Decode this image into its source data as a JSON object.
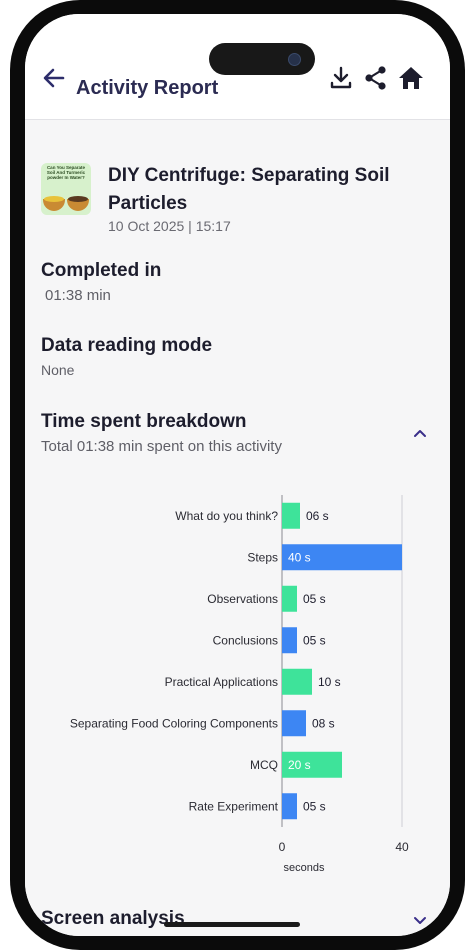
{
  "header": {
    "title": "Activity Report",
    "icons": [
      "back-arrow-icon",
      "download-icon",
      "share-icon",
      "home-icon"
    ]
  },
  "activity": {
    "thumbnail_text": "Can You Separate Soil And Turmeric powder In Water?",
    "title": "DIY Centrifuge: Separating Soil Particles",
    "datetime": "10 Oct 2025 | 15:17"
  },
  "completed": {
    "label": "Completed in",
    "value": "01:38 min"
  },
  "reading_mode": {
    "label": "Data reading mode",
    "value": "None"
  },
  "breakdown": {
    "label": "Time spent breakdown",
    "summary": "Total 01:38 min spent on this activity",
    "expanded": true
  },
  "chart_data": {
    "type": "bar",
    "orientation": "horizontal",
    "categories": [
      "What do you think?",
      "Steps",
      "Observations",
      "Conclusions",
      "Practical Applications",
      "Separating Food Coloring Components",
      "MCQ",
      "Rate Experiment"
    ],
    "values": [
      6,
      40,
      5,
      5,
      10,
      8,
      20,
      5
    ],
    "value_labels": [
      "06 s",
      "40 s",
      "05 s",
      "05 s",
      "10 s",
      "08 s",
      "20 s",
      "05 s"
    ],
    "colors": [
      "#3ee39a",
      "#3d86f3",
      "#3ee39a",
      "#3d86f3",
      "#3ee39a",
      "#3d86f3",
      "#3ee39a",
      "#3d86f3"
    ],
    "xlabel": "seconds",
    "xlim": [
      0,
      40
    ],
    "xticks": [
      "0",
      "40"
    ]
  },
  "screen_analysis": {
    "label": "Screen analysis",
    "expanded": false
  }
}
